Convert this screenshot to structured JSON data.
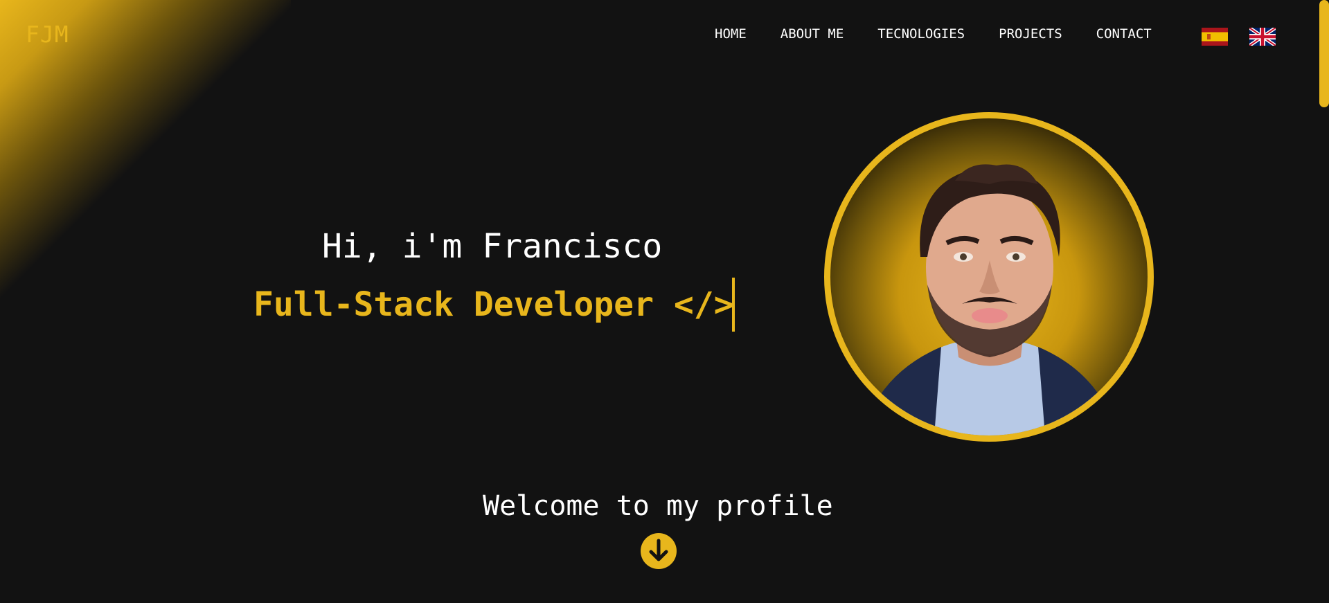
{
  "brand": {
    "logo": "FJM"
  },
  "nav": {
    "items": [
      {
        "label": "HOME"
      },
      {
        "label": "ABOUT ME"
      },
      {
        "label": "TECNOLOGIES"
      },
      {
        "label": "PROJECTS"
      },
      {
        "label": "CONTACT"
      }
    ],
    "languages": [
      {
        "icon": "spain-flag-icon"
      },
      {
        "icon": "uk-flag-icon"
      }
    ]
  },
  "hero": {
    "greeting": "Hi, i'm Francisco",
    "role": "Full-Stack Developer </>"
  },
  "welcome": {
    "text": "Welcome to my profile",
    "icon": "arrow-down-icon"
  },
  "colors": {
    "accent": "#e8b61c",
    "background": "#121212",
    "text": "#ffffff"
  }
}
